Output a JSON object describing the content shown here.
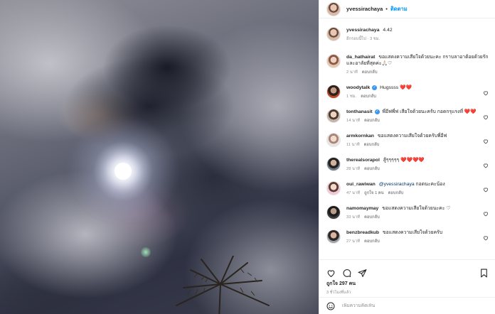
{
  "post": {
    "author": "yvessirachaya",
    "follow_label": "ติดตาม",
    "separator": "•"
  },
  "caption": {
    "username": "yvessirachaya",
    "text": "4.42",
    "meta_time": "อีกรอบนี้ไป · 3 ชม."
  },
  "comments": [
    {
      "username": "da_hathairat",
      "verified": false,
      "text": "ขอแสดงความเสียใจด้วยนะคะ กราบลาอาต้อยด้วยรักและอาลัยที่สุดค่ะ🙏🏻♡",
      "time": "2 นาที",
      "likes": "",
      "reply": "ตอบกลับ"
    },
    {
      "username": "woodytalk",
      "verified": true,
      "text": "Hugssss ❤️❤️",
      "time": "1 ชม.",
      "likes": "",
      "reply": "ตอบกลับ"
    },
    {
      "username": "tonthanasit",
      "verified": true,
      "text": "พี่อีฟพี่ฟ เสียใจด้วยนะครับ กอดกรุแรงที่ ❤️❤️",
      "time": "14 นาที",
      "likes": "",
      "reply": "ตอบกลับ"
    },
    {
      "username": "armkornkan",
      "verified": false,
      "text": "ขอแสดงความเสียใจด้วยครับพี่อีฟ",
      "time": "11 นาที",
      "likes": "",
      "reply": "ตอบกลับ"
    },
    {
      "username": "therealsorapol",
      "verified": false,
      "text": "สู้ๆๆๆๆๆ ❤️❤️❤️❤️",
      "time": "28 นาที",
      "likes": "",
      "reply": "ตอบกลับ"
    },
    {
      "username": "oui_rawiwan",
      "verified": false,
      "mention": "@yvessirachaya",
      "text": "กอดนะคะน้อง",
      "time": "47 นาที",
      "likes": "ถูกใจ 1 คน",
      "reply": "ตอบกลับ"
    },
    {
      "username": "namomaymay",
      "verified": false,
      "text": "ขอแสดงความเสียใจด้วยนะคะ ♡",
      "time": "33 นาที",
      "likes": "",
      "reply": "ตอบกลับ"
    },
    {
      "username": "benzbreadkub",
      "verified": false,
      "text": "ขอแสดงความเสียใจด้วยครับ",
      "time": "27 นาที",
      "likes": "",
      "reply": "ตอบกลับ"
    }
  ],
  "actions": {
    "likes_prefix": "ถูกใจ",
    "likes_count": "297",
    "likes_suffix": "คน",
    "posted": "3 ชั่วโมงที่แล้ว"
  },
  "add_comment": {
    "placeholder": "เพิ่มความคิดเห็น"
  },
  "icons": {
    "like": "heart-icon",
    "comment": "comment-bubble-icon",
    "share": "paper-plane-icon",
    "save": "bookmark-icon",
    "emoji": "emoji-icon"
  },
  "colors": {
    "link_blue": "#0095f6",
    "heart_red": "#ed4956",
    "muted": "#8e8e8e"
  }
}
